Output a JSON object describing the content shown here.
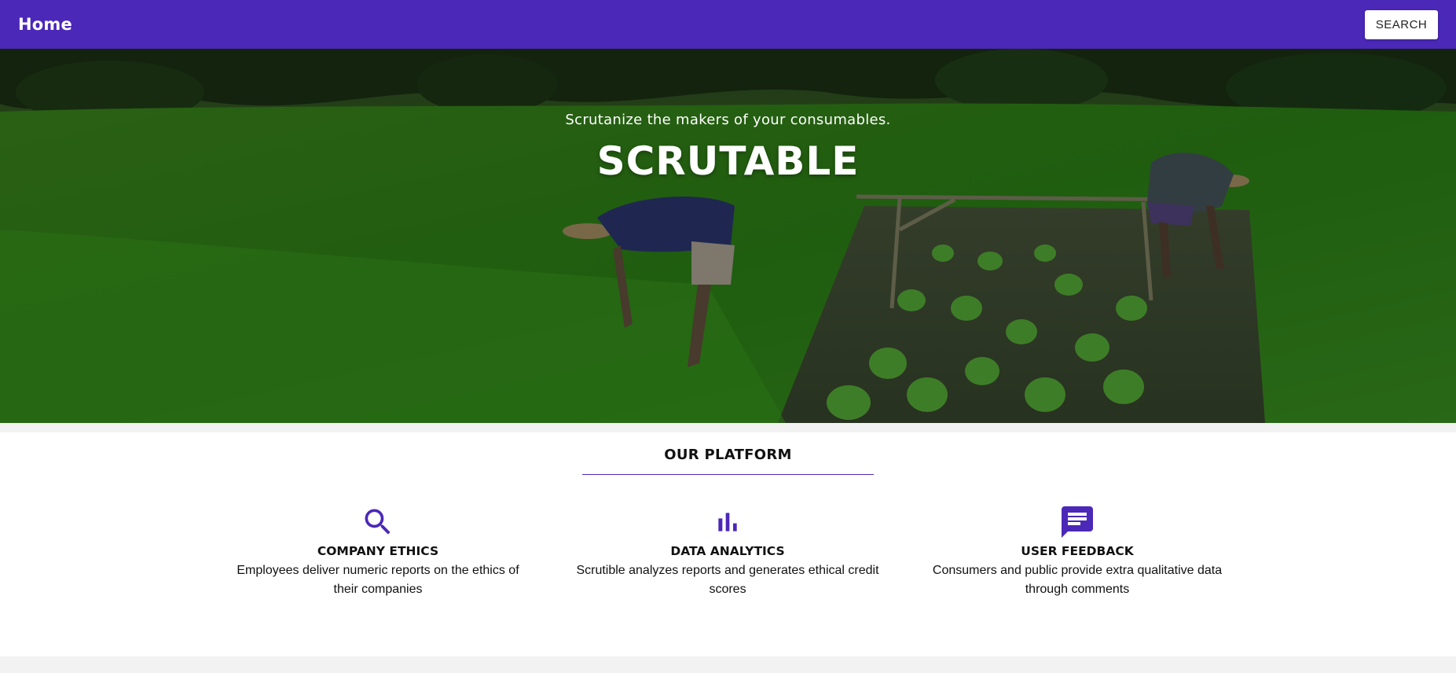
{
  "appbar": {
    "home_label": "Home",
    "search_label": "SEARCH",
    "color": "#4b28b8"
  },
  "hero": {
    "tagline": "Scrutanize the makers of your consumables.",
    "title": "SCRUTABLE",
    "image": "rice-field-farmers-photo"
  },
  "platform": {
    "heading": "OUR PLATFORM",
    "accent_color": "#4b28b8",
    "features": [
      {
        "icon": "search-icon",
        "title": "COMPANY ETHICS",
        "description": "Employees deliver numeric reports on the ethics of their companies"
      },
      {
        "icon": "bar-chart-icon",
        "title": "DATA ANALYTICS",
        "description": "Scrutible analyzes reports and generates ethical credit scores"
      },
      {
        "icon": "comment-icon",
        "title": "USER FEEDBACK",
        "description": "Consumers and public provide extra qualitative data through comments"
      }
    ]
  }
}
